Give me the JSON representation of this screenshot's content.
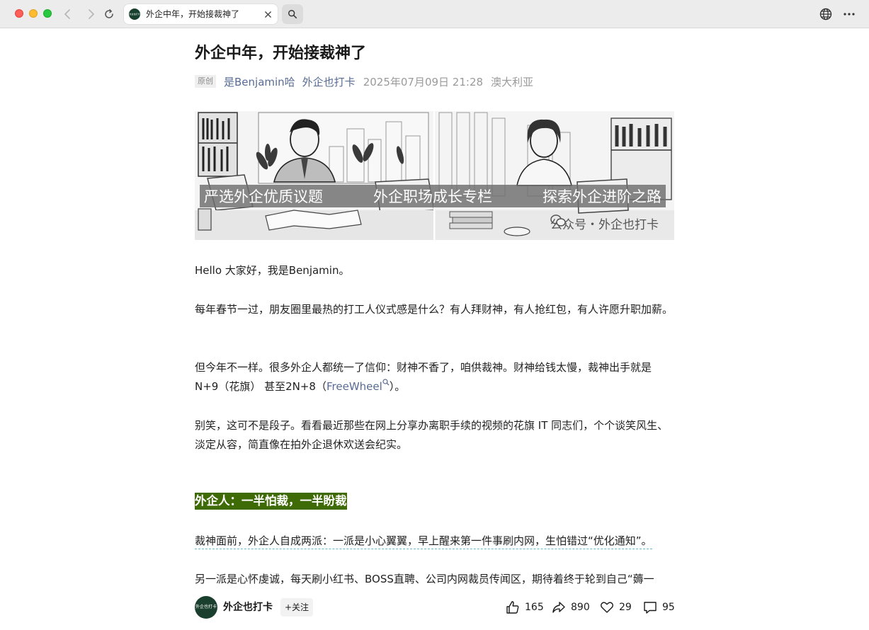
{
  "browser": {
    "tab_title": "外企中年，开始接裁神了",
    "favicon_text": "外企也打卡"
  },
  "article": {
    "title": "外企中年，开始接裁神了",
    "meta": {
      "badge": "原创",
      "author": "是Benjamin哈",
      "account": "外企也打卡",
      "time": "2025年07月09日 21:28",
      "location": "澳大利亚"
    },
    "banner": {
      "slogans": [
        "严选外企优质议题",
        "外企职场成长专栏",
        "探索外企进阶之路"
      ],
      "watermark": "公众号・外企也打卡"
    },
    "paragraphs": {
      "p1": "Hello 大家好，我是Benjamin。",
      "p2": "每年春节一过，朋友圈里最热的打工人仪式感是什么？有人拜财神，有人抢红包，有人许愿升职加薪。",
      "p3_before": "但今年不一样。很多外企人都统一了信仰：财神不香了，咱供裁神。财神给钱太慢，裁神出手就是N+9（花旗） 甚至2N+8（",
      "p3_link": "FreeWheel",
      "p3_after": "）。",
      "p4": "别笑，这可不是段子。看看最近那些在网上分享办离职手续的视频的花旗 IT 同志们，个个谈笑风生、淡定从容，简直像在拍外企退休欢送会纪实。",
      "heading": "外企人：一半怕裁，一半盼裁",
      "p5": "裁神面前，外企人自成两派：一派是小心翼翼，早上醒来第一件事刷内网，生怕错过“优化通知”。",
      "p6": "另一派是心怀虔诚，每天刷小红书、BOSS直聘、公司内网裁员传闻区，期待着终于轮到自己“薅一"
    }
  },
  "bottom_bar": {
    "account_name": "外企也打卡",
    "avatar_text": "外企也打卡",
    "follow_label": "+关注",
    "likes": "165",
    "shares": "890",
    "favorites": "29",
    "comments": "95"
  }
}
